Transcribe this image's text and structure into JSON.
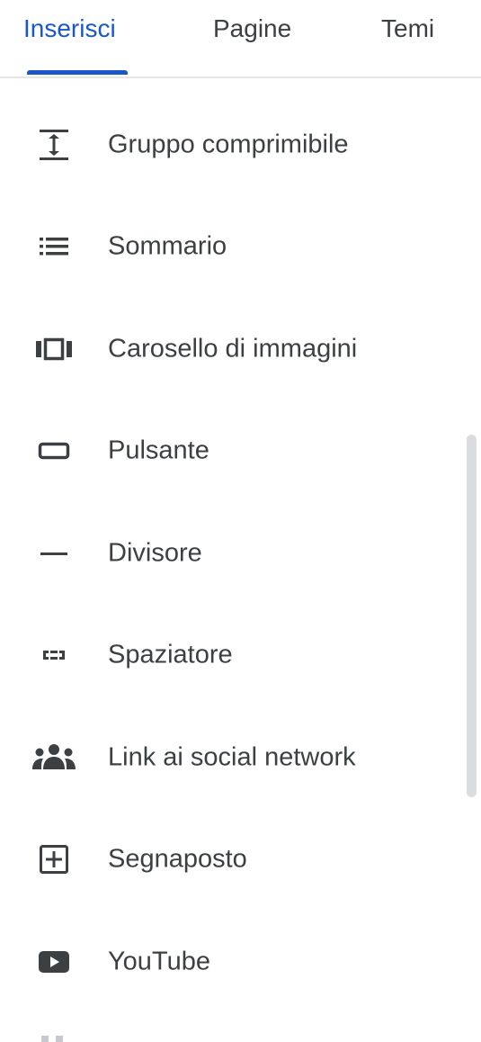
{
  "tabs": [
    {
      "label": "Inserisci",
      "active": true
    },
    {
      "label": "Pagine",
      "active": false
    },
    {
      "label": "Temi",
      "active": false
    }
  ],
  "items": [
    {
      "label": "Gruppo comprimibile",
      "icon": "collapsible-group-icon"
    },
    {
      "label": "Sommario",
      "icon": "table-of-contents-icon"
    },
    {
      "label": "Carosello di immagini",
      "icon": "image-carousel-icon"
    },
    {
      "label": "Pulsante",
      "icon": "button-icon"
    },
    {
      "label": "Divisore",
      "icon": "divider-icon"
    },
    {
      "label": "Spaziatore",
      "icon": "spacer-icon"
    },
    {
      "label": "Link ai social network",
      "icon": "social-links-icon"
    },
    {
      "label": "Segnaposto",
      "icon": "placeholder-icon"
    },
    {
      "label": "YouTube",
      "icon": "youtube-icon"
    }
  ],
  "colors": {
    "accent": "#1a57c9",
    "text": "#3c4043",
    "icon": "#3c4043",
    "scrollbar": "#dadce0"
  }
}
